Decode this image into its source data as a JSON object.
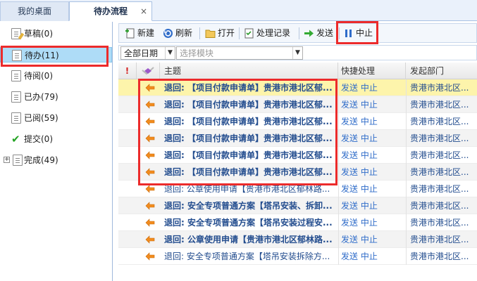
{
  "tabs": [
    {
      "label": "我的桌面"
    },
    {
      "label": "待办流程",
      "close": "×"
    }
  ],
  "sidebar": {
    "items": [
      {
        "label": "草稿(0)"
      },
      {
        "label": "待办(11)"
      },
      {
        "label": "待阅(0)"
      },
      {
        "label": "已办(79)"
      },
      {
        "label": "已阅(59)"
      },
      {
        "label": "提交(0)"
      },
      {
        "label": "完成(49)"
      }
    ]
  },
  "toolbar": {
    "new_label": "新建",
    "refresh_label": "刷新",
    "open_label": "打开",
    "records_label": "处理记录",
    "send_label": "发送",
    "stop_label": "中止"
  },
  "filter": {
    "date_value": "全部日期",
    "module_placeholder": "选择模块"
  },
  "grid": {
    "headers": {
      "subject": "主题",
      "action": "快捷处理",
      "dept": "发起部门"
    },
    "rows": [
      {
        "subject": "退回: 【项目付款申请单】贵港市港北区郁...",
        "action": "发送 中止",
        "dept": "贵港市港北区..."
      },
      {
        "subject": "退回: 【项目付款申请单】贵港市港北区郁...",
        "action": "发送 中止",
        "dept": "贵港市港北区..."
      },
      {
        "subject": "退回: 【项目付款申请单】贵港市港北区郁...",
        "action": "发送 中止",
        "dept": "贵港市港北区..."
      },
      {
        "subject": "退回: 【项目付款申请单】贵港市港北区郁...",
        "action": "发送 中止",
        "dept": "贵港市港北区..."
      },
      {
        "subject": "退回: 【项目付款申请单】贵港市港北区郁...",
        "action": "发送 中止",
        "dept": "贵港市港北区..."
      },
      {
        "subject": "退回: 【项目付款申请单】贵港市港北区郁...",
        "action": "发送 中止",
        "dept": "贵港市港北区..."
      },
      {
        "subject": "退回: 公章使用申请【贵港市港北区郁林路...",
        "action": "发送 中止",
        "dept": "贵港市港北区..."
      },
      {
        "subject": "退回: 安全专项普通方案【塔吊安装、拆卸...",
        "action": "发送 中止",
        "dept": "贵港市港北区..."
      },
      {
        "subject": "退回: 安全专项普通方案【塔吊安装过程安...",
        "action": "发送 中止",
        "dept": "贵港市港北区..."
      },
      {
        "subject": "退回: 公章使用申请【贵港市港北区郁林路...",
        "action": "发送 中止",
        "dept": "贵港市港北区..."
      },
      {
        "subject": "退回: 安全专项普通方案【塔吊安装拆除方...",
        "action": "发送 中止",
        "dept": "贵港市港北区..."
      }
    ]
  },
  "colors": {
    "highlight_red": "#ec2b2b",
    "selected_row": "#fdf4ab",
    "selected_sidebar": "#aedcf7",
    "link_blue": "#224c8e"
  }
}
